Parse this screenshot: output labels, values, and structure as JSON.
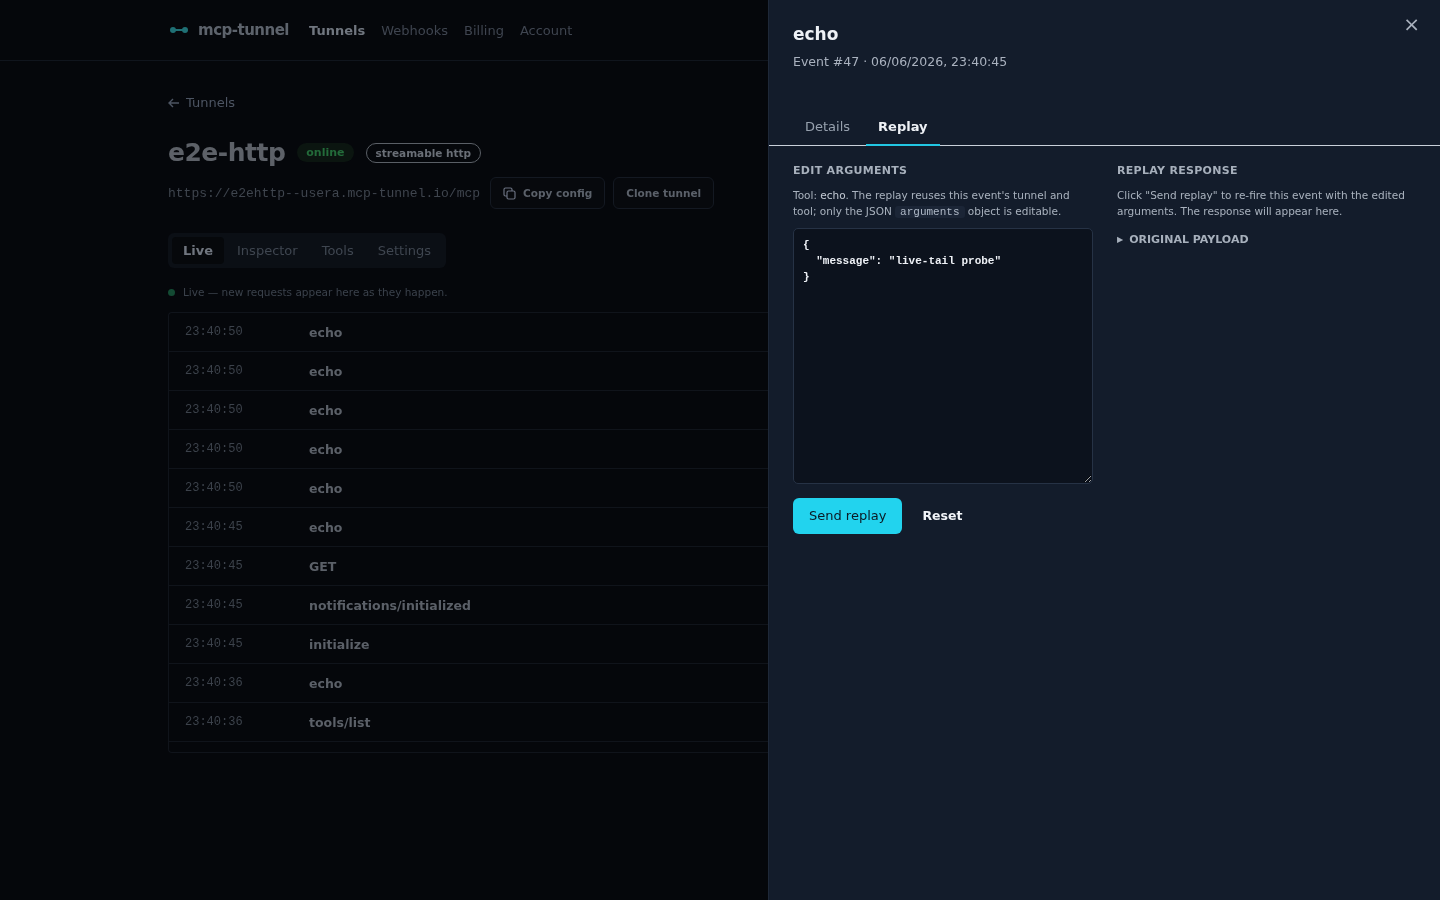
{
  "nav": {
    "brand": "mcp-tunnel",
    "links": [
      {
        "label": "Tunnels",
        "selected": true
      },
      {
        "label": "Webhooks",
        "selected": false
      },
      {
        "label": "Billing",
        "selected": false
      },
      {
        "label": "Account",
        "selected": false
      }
    ]
  },
  "back_link": "Tunnels",
  "tunnel": {
    "name": "e2e-http",
    "status": "online",
    "transport": "streamable http",
    "url": "https://e2ehttp--usera.mcp-tunnel.io/mcp",
    "buttons": [
      {
        "label": "Copy config",
        "kind": "copy"
      },
      {
        "label": "Clone tunnel",
        "kind": "plain"
      }
    ]
  },
  "tabs": [
    {
      "label": "Live",
      "selected": true
    },
    {
      "label": "Inspector",
      "selected": false
    },
    {
      "label": "Tools",
      "selected": false
    },
    {
      "label": "Settings",
      "selected": false
    }
  ],
  "live_note": "Live — new requests appear here as they happen.",
  "events": [
    {
      "time": "23:40:50",
      "method": "echo"
    },
    {
      "time": "23:40:50",
      "method": "echo"
    },
    {
      "time": "23:40:50",
      "method": "echo"
    },
    {
      "time": "23:40:50",
      "method": "echo"
    },
    {
      "time": "23:40:50",
      "method": "echo"
    },
    {
      "time": "23:40:45",
      "method": "echo"
    },
    {
      "time": "23:40:45",
      "method": "GET"
    },
    {
      "time": "23:40:45",
      "method": "notifications/initialized"
    },
    {
      "time": "23:40:45",
      "method": "initialize"
    },
    {
      "time": "23:40:36",
      "method": "echo"
    },
    {
      "time": "23:40:36",
      "method": "tools/list"
    }
  ],
  "drawer": {
    "title": "echo",
    "subtitle": "Event #47 · 06/06/2026, 23:40:45",
    "close": "×",
    "tabs": [
      {
        "label": "Details",
        "selected": false
      },
      {
        "label": "Replay",
        "selected": true
      }
    ],
    "edit": {
      "heading": "EDIT ARGUMENTS",
      "description": [
        {
          "kind": "text",
          "text": "Tool: "
        },
        {
          "kind": "name",
          "text": "echo"
        },
        {
          "kind": "text",
          "text": ". The replay reuses this event's tunnel and tool; only the JSON "
        },
        {
          "kind": "code",
          "text": "arguments"
        },
        {
          "kind": "text",
          "text": " object is editable."
        }
      ],
      "value": "{\n  \"message\": \"live-tail probe\"\n}",
      "send": "Send replay",
      "reset": "Reset"
    },
    "response": {
      "heading": "REPLAY RESPONSE",
      "text": "Click \"Send replay\" to re-fire this event with the edited arguments. The response will appear here.",
      "toggle": "▶",
      "payload_label": "ORIGINAL PAYLOAD",
      "expanded": false
    }
  }
}
